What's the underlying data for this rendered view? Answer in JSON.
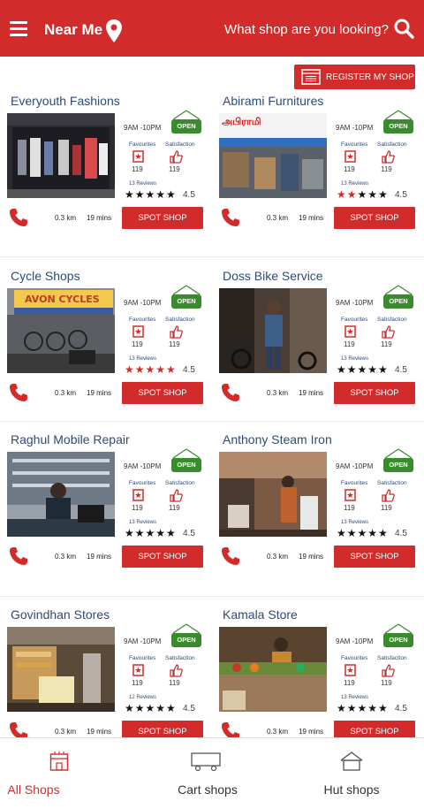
{
  "header": {
    "location_label": "Near Me",
    "search_placeholder": "What shop are you looking?"
  },
  "register_label": "REGISTER MY SHOP",
  "shops": [
    {
      "name": "Everyouth Fashions",
      "hours": "9AM -10PM",
      "open": "OPEN",
      "fav_label": "Favourites",
      "sat_label": "Satisfaction",
      "fav_count": "119",
      "sat_count": "119",
      "reviews": "13 Reviews",
      "stars_filled": 5,
      "rating": "4.5",
      "distance": "0.3 km",
      "time": "19 mins",
      "spot_label": "SPOT SHOP"
    },
    {
      "name": "Abirami Furnitures",
      "hours": "9AM -10PM",
      "open": "OPEN",
      "fav_label": "Favourites",
      "sat_label": "Satisfaction",
      "fav_count": "119",
      "sat_count": "119",
      "reviews": "13 Reviews",
      "stars_filled": 5,
      "red_stars": 2,
      "rating": "4.5",
      "distance": "0.3 km",
      "time": "19 mins",
      "spot_label": "SPOT SHOP"
    },
    {
      "name": "Cycle Shops",
      "hours": "9AM -10PM",
      "open": "OPEN",
      "fav_label": "Favourites",
      "sat_label": "Satisfaction",
      "fav_count": "119",
      "sat_count": "119",
      "reviews": "13 Reviews",
      "stars_filled": 5,
      "red_stars": 5,
      "rating": "4.5",
      "distance": "0.3 km",
      "time": "19 mins",
      "spot_label": "SPOT SHOP"
    },
    {
      "name": "Doss Bike Service",
      "hours": "9AM -10PM",
      "open": "OPEN",
      "fav_label": "Favourites",
      "sat_label": "Satisfaction",
      "fav_count": "119",
      "sat_count": "119",
      "reviews": "13 Reviews",
      "stars_filled": 5,
      "rating": "4.5",
      "distance": "0.3 km",
      "time": "19 mins",
      "spot_label": "SPOT SHOP"
    },
    {
      "name": "Raghul Mobile Repair",
      "hours": "9AM -10PM",
      "open": "OPEN",
      "fav_label": "Favourites",
      "sat_label": "Satisfaction",
      "fav_count": "119",
      "sat_count": "119",
      "reviews": "13 Reviews",
      "stars_filled": 5,
      "rating": "4.5",
      "distance": "0.3 km",
      "time": "19 mins",
      "spot_label": "SPOT SHOP"
    },
    {
      "name": "Anthony Steam Iron",
      "hours": "9AM -10PM",
      "open": "OPEN",
      "fav_label": "Favourites",
      "sat_label": "Satisfaction",
      "fav_count": "119",
      "sat_count": "119",
      "reviews": "13 Reviews",
      "stars_filled": 5,
      "rating": "4.5",
      "distance": "0.3 km",
      "time": "19 mins",
      "spot_label": "SPOT SHOP"
    },
    {
      "name": "Govindhan Stores",
      "hours": "9AM -10PM",
      "open": "OPEN",
      "fav_label": "Favourites",
      "sat_label": "Satisfaction",
      "fav_count": "119",
      "sat_count": "119",
      "reviews": "12 Reviews",
      "stars_filled": 5,
      "rating": "4.5",
      "distance": "0.3 km",
      "time": "19 mins",
      "spot_label": "SPOT SHOP"
    },
    {
      "name": "Kamala Store",
      "hours": "9AM -10PM",
      "open": "OPEN",
      "fav_label": "Favourites",
      "sat_label": "Satisfaction",
      "fav_count": "119",
      "sat_count": "119",
      "reviews": "13 Reviews",
      "stars_filled": 5,
      "rating": "4.5",
      "distance": "0.3 km",
      "time": "19 mins",
      "spot_label": "SPOT SHOP"
    }
  ],
  "image_signs": {
    "abirami": "அபிராமி",
    "avon": "AVON CYCLES"
  },
  "bottom_nav": [
    {
      "label": "All Shops",
      "active": true,
      "icon": "storefront-icon"
    },
    {
      "label": "Cart shops",
      "active": false,
      "icon": "cart-icon"
    },
    {
      "label": "Hut shops",
      "active": false,
      "icon": "hut-icon"
    }
  ],
  "colors": {
    "brand": "#d12b2b",
    "open_sign": "#3a8a2e",
    "link_blue": "#2c4a7a"
  }
}
